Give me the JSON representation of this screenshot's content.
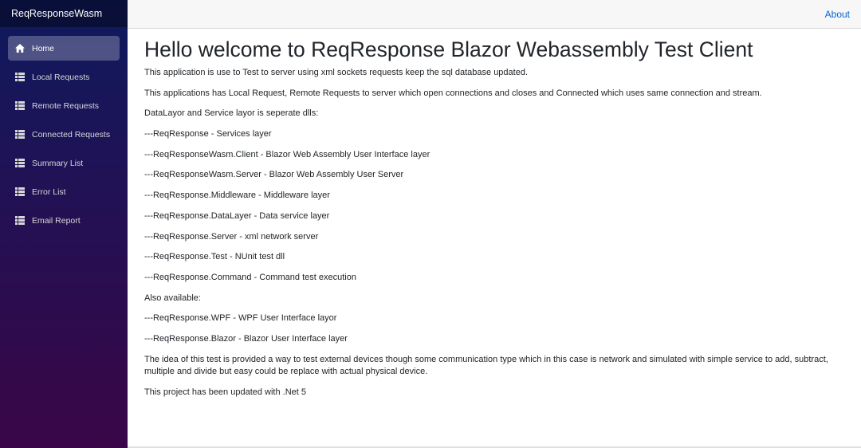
{
  "app": {
    "brand": "ReqResponseWasm"
  },
  "topbar": {
    "about": "About"
  },
  "sidebar": {
    "items": [
      {
        "label": "Home",
        "icon": "home-icon",
        "active": true
      },
      {
        "label": "Local Requests",
        "icon": "list-icon"
      },
      {
        "label": "Remote Requests",
        "icon": "list-icon"
      },
      {
        "label": "Connected Requests",
        "icon": "list-icon"
      },
      {
        "label": "Summary List",
        "icon": "list-icon"
      },
      {
        "label": "Error List",
        "icon": "list-icon"
      },
      {
        "label": "Email Report",
        "icon": "list-icon"
      }
    ]
  },
  "main": {
    "title": "Hello welcome to ReqResponse Blazor Webassembly Test Client",
    "paragraphs": [
      "This application is use to Test to server using xml sockets requests keep the sql database updated.",
      "This applications has Local Request, Remote Requests to server which open connections and closes and Connected which uses same connection and stream.",
      "DataLayor and Service layor is seperate dlls:",
      "---ReqResponse - Services layer",
      "---ReqResponseWasm.Client - Blazor Web Assembly User Interface layer",
      "---ReqResponseWasm.Server - Blazor Web Assembly User Server",
      "---ReqResponse.Middleware - Middleware layer",
      "---ReqResponse.DataLayer - Data service layer",
      "---ReqResponse.Server - xml network server",
      "---ReqResponse.Test - NUnit test dll",
      "---ReqResponse.Command - Command test execution",
      "Also available:",
      "---ReqResponse.WPF - WPF User Interface layor",
      "---ReqResponse.Blazor - Blazor User Interface layer",
      "The idea of this test is provided a way to test external devices though some communication type which in this case is network and simulated with simple service to add, subtract, multiple and divide but easy could be replace with actual physical device.",
      "This project has been updated with .Net 5"
    ]
  },
  "colors": {
    "sidebar_top": "#0e1a5e",
    "sidebar_bottom": "#3a0647",
    "link": "#0366d6"
  }
}
